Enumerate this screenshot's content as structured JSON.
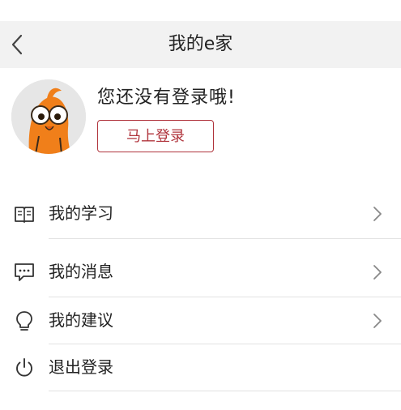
{
  "header": {
    "title": "我的e家",
    "back_icon": "chevron-left-icon"
  },
  "profile": {
    "message": "您还没有登录哦!",
    "login_button": "马上登录",
    "avatar": "mascot-avatar"
  },
  "menu": {
    "items": [
      {
        "label": "我的学习",
        "icon": "book-icon",
        "has_arrow": true
      },
      {
        "label": "我的消息",
        "icon": "message-icon",
        "has_arrow": true
      },
      {
        "label": "我的建议",
        "icon": "lightbulb-icon",
        "has_arrow": true
      },
      {
        "label": "退出登录",
        "icon": "power-icon",
        "has_arrow": false
      }
    ]
  },
  "colors": {
    "accent": "#b0343c",
    "header_bg": "#f2f2f2",
    "mascot_orange": "#f07f1a"
  }
}
